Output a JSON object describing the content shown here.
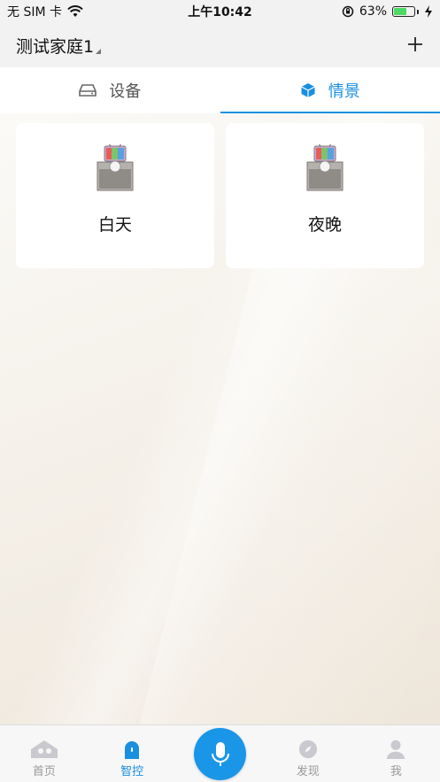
{
  "status_bar": {
    "carrier": "无 SIM 卡",
    "time": "上午10:42",
    "battery_percent": "63%",
    "battery_level": 0.63
  },
  "header": {
    "home_name": "测试家庭1",
    "add_icon": "plus-icon"
  },
  "tabs": [
    {
      "label": "设备",
      "icon": "device-icon",
      "active": false
    },
    {
      "label": "情景",
      "icon": "cube-icon",
      "active": true
    }
  ],
  "scenes": [
    {
      "label": "白天",
      "icon": "scene-tv-icon"
    },
    {
      "label": "夜晚",
      "icon": "scene-tv-icon"
    }
  ],
  "tabbar": {
    "items": [
      {
        "label": "首页",
        "icon": "home-icon",
        "active": false
      },
      {
        "label": "智控",
        "icon": "smart-control-icon",
        "active": true
      },
      {
        "label": "",
        "icon": "microphone-icon",
        "active": false
      },
      {
        "label": "发现",
        "icon": "compass-icon",
        "active": false
      },
      {
        "label": "我",
        "icon": "user-icon",
        "active": false
      }
    ]
  },
  "colors": {
    "accent": "#1a8fe0",
    "battery_green": "#4cd964",
    "mic_button": "#1a96e8"
  }
}
